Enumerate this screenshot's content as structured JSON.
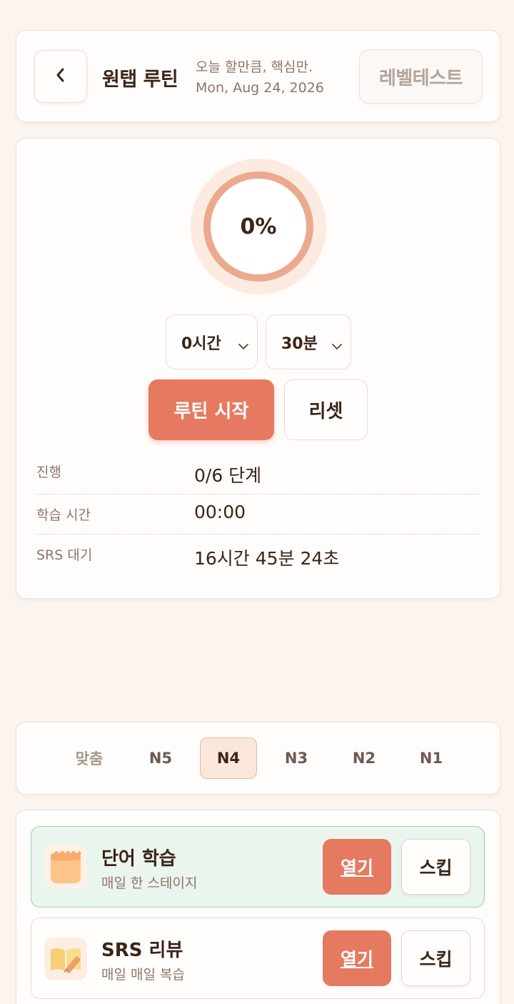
{
  "header": {
    "back_icon": "chevron-left-icon",
    "title": "원탭 루틴",
    "tagline": "오늘 할만큼, 핵심만.",
    "date": "Mon, Aug 24, 2026",
    "level_test_label": "레벨테스트"
  },
  "progress": {
    "percent_label": "0%",
    "percent_value": 0,
    "ring_color": "#eba98e"
  },
  "duration": {
    "hours_value": "0시간",
    "minutes_value": "30분"
  },
  "actions": {
    "start_label": "루틴 시작",
    "reset_label": "리셋"
  },
  "stats": [
    {
      "label": "진행",
      "value": "0/6 단계"
    },
    {
      "label": "학습 시간",
      "value": "00:00"
    },
    {
      "label": "SRS 대기",
      "value": "16시간 45분 24초"
    }
  ],
  "levels": {
    "items": [
      "맞춤",
      "N5",
      "N4",
      "N3",
      "N2",
      "N1"
    ],
    "selected": "N4"
  },
  "tasks": [
    {
      "title": "단어 학습",
      "subtitle": "매일 한 스테이지",
      "icon": "notepad-icon",
      "open_label": "열기",
      "skip_label": "스킵",
      "status": "done"
    },
    {
      "title": "SRS 리뷰",
      "subtitle": "매일 매일 복습",
      "icon": "book-pencil-icon",
      "open_label": "열기",
      "skip_label": "스킵",
      "status": "todo"
    }
  ],
  "colors": {
    "accent": "#e57a60",
    "background": "#fcf4ef",
    "done_bg": "#eaf5ee",
    "done_border": "#9fd1ae"
  }
}
